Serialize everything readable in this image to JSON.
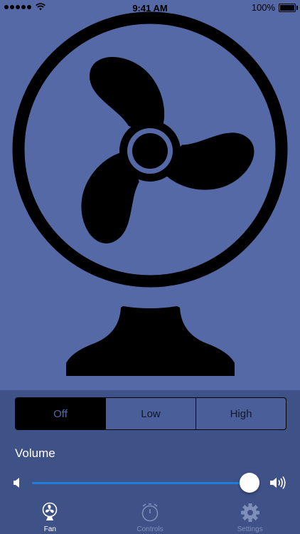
{
  "status_bar": {
    "time": "9:41 AM",
    "battery": "100%",
    "signal_icon": "signal-dots-icon",
    "wifi_icon": "wifi-icon",
    "battery_icon": "battery-icon"
  },
  "colors": {
    "background": "#5569a6",
    "panel": "#3f5288",
    "accent": "#1f7dde",
    "fan": "#000000"
  },
  "speed_control": {
    "options": [
      "Off",
      "Low",
      "High"
    ],
    "selected": "Off"
  },
  "volume": {
    "label": "Volume",
    "level": 0.95,
    "low_icon": "speaker-low-icon",
    "high_icon": "speaker-high-icon"
  },
  "tab_bar": {
    "tabs": [
      {
        "label": "Fan",
        "icon": "fan-icon",
        "active": true
      },
      {
        "label": "Controls",
        "icon": "timer-icon",
        "active": false
      },
      {
        "label": "Settings",
        "icon": "gear-icon",
        "active": false
      }
    ]
  }
}
